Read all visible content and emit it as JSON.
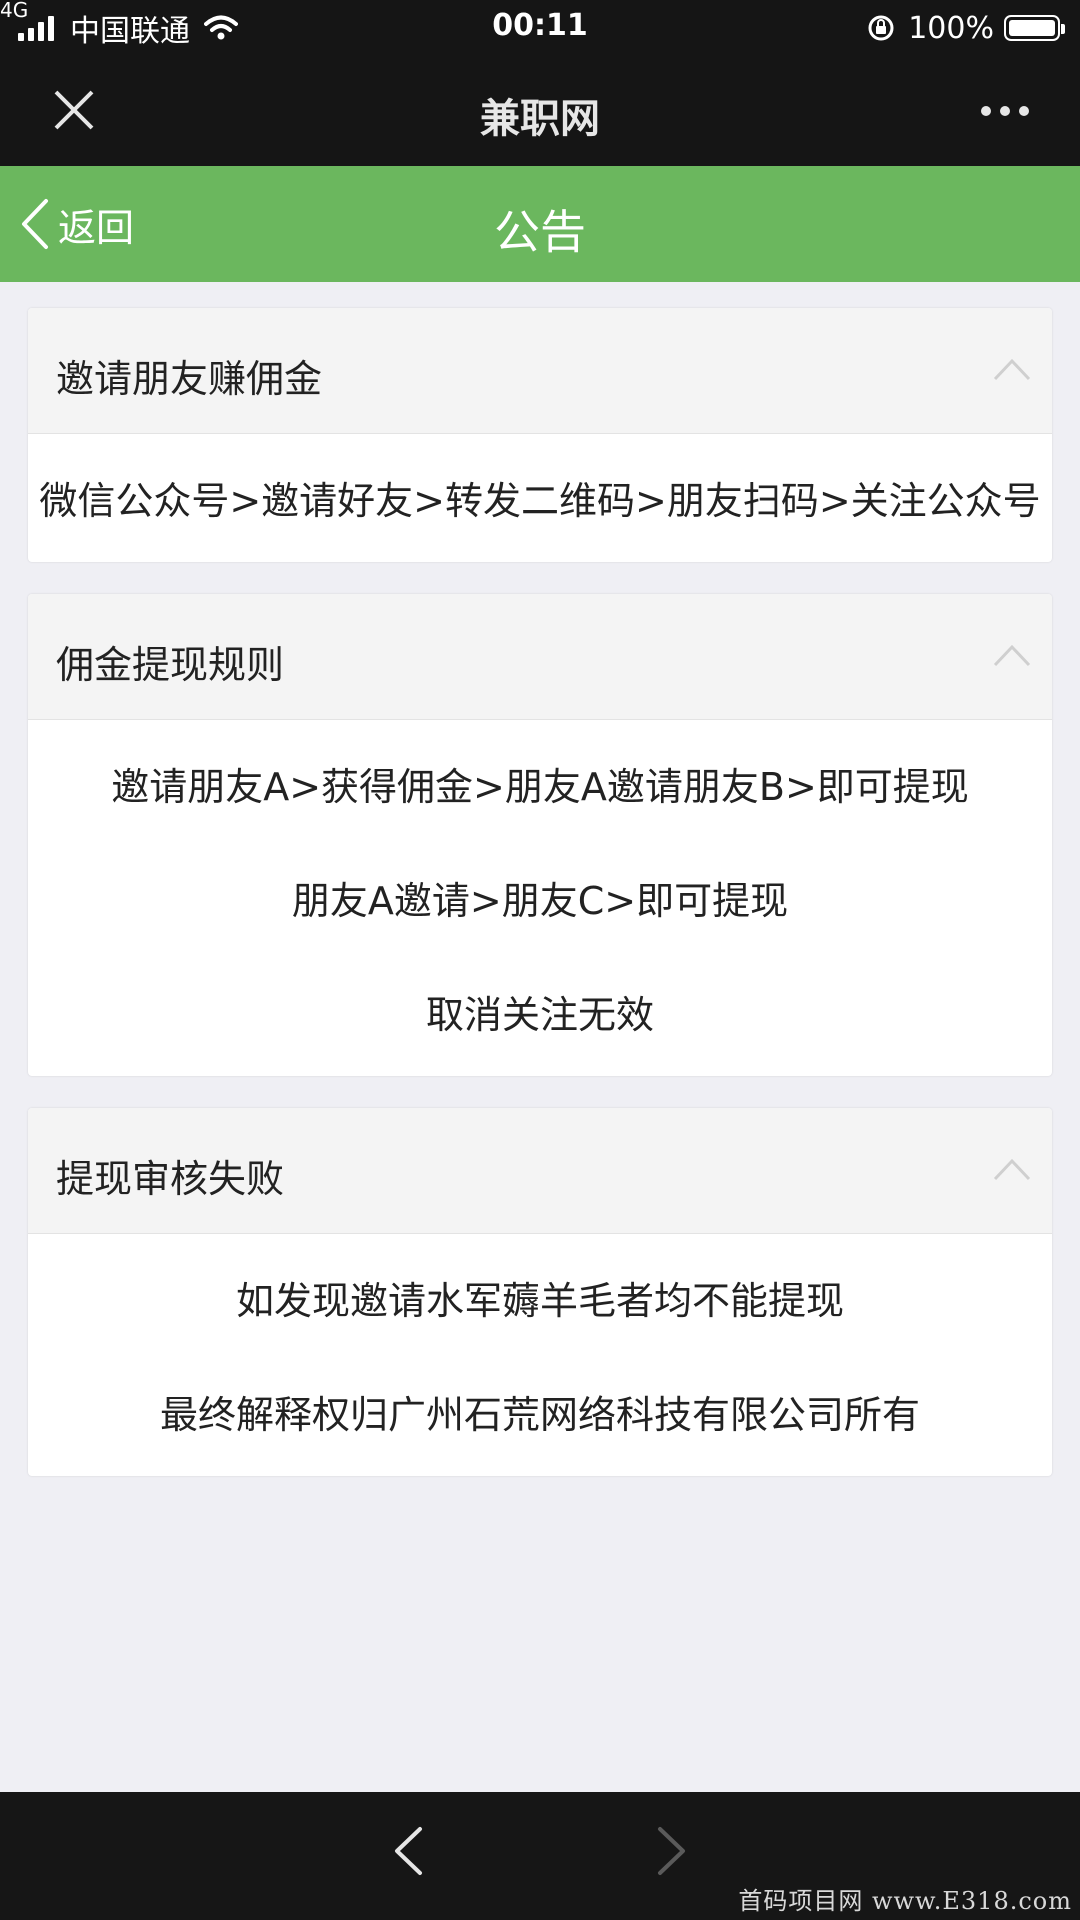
{
  "status_bar": {
    "network": "4G",
    "carrier": "中国联通",
    "time": "00:11",
    "battery": "100%",
    "battery_level": 1.0
  },
  "wechat_bar": {
    "title": "兼职网"
  },
  "page_header": {
    "back_label": "返回",
    "title": "公告",
    "color": "#6bb75e"
  },
  "sections": [
    {
      "title": "邀请朋友赚佣金",
      "lines": [
        "微信公众号>邀请好友>转发二维码>朋友扫码>关注公众号"
      ]
    },
    {
      "title": "佣金提现规则",
      "lines": [
        "邀请朋友A>获得佣金>朋友A邀请朋友B>即可提现",
        "朋友A邀请>朋友C>即可提现",
        "取消关注无效"
      ]
    },
    {
      "title": "提现审核失败",
      "lines": [
        "如发现邀请水军薅羊毛者均不能提现",
        "最终解释权归广州石荒网络科技有限公司所有"
      ]
    }
  ],
  "icons": {
    "close": "close-icon",
    "more": "more-icon",
    "back": "chevron-left-icon",
    "collapse": "chevron-up-icon",
    "nav_back": "arrow-left-icon",
    "nav_forward": "arrow-right-icon"
  },
  "watermark": "首码项目网 www.E318.com"
}
